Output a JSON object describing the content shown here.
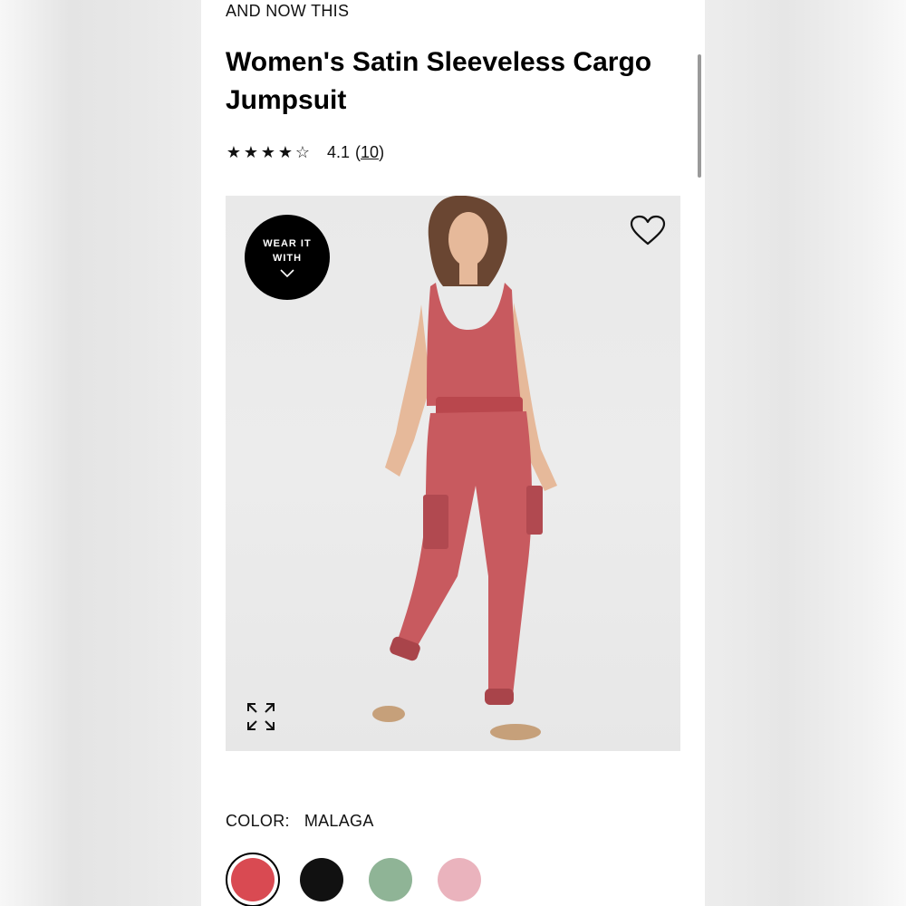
{
  "product": {
    "brand": "AND NOW THIS",
    "title": "Women's Satin Sleeveless Cargo Jumpsuit",
    "rating": {
      "stars": 4.1,
      "value_label": "4.1",
      "count_open": "(",
      "count": "10",
      "count_close": ")"
    }
  },
  "gallery": {
    "wear_it_label_1": "WEAR IT",
    "wear_it_label_2": "WITH",
    "icons": {
      "wishlist": "heart-icon",
      "expand": "expand-icon",
      "wear_it": "chevron-down-icon"
    }
  },
  "color": {
    "label": "COLOR:",
    "selected": "MALAGA",
    "swatches": [
      {
        "name": "malaga",
        "hex": "#d94a52",
        "selected": true
      },
      {
        "name": "black",
        "hex": "#111111",
        "selected": false
      },
      {
        "name": "sage",
        "hex": "#8fb496",
        "selected": false
      },
      {
        "name": "pink",
        "hex": "#eab3bd",
        "selected": false
      }
    ]
  },
  "colors": {
    "garment": "#c85a5f",
    "garment_dark": "#a9444a",
    "skin": "#e6b99a",
    "hair": "#6a4632"
  }
}
